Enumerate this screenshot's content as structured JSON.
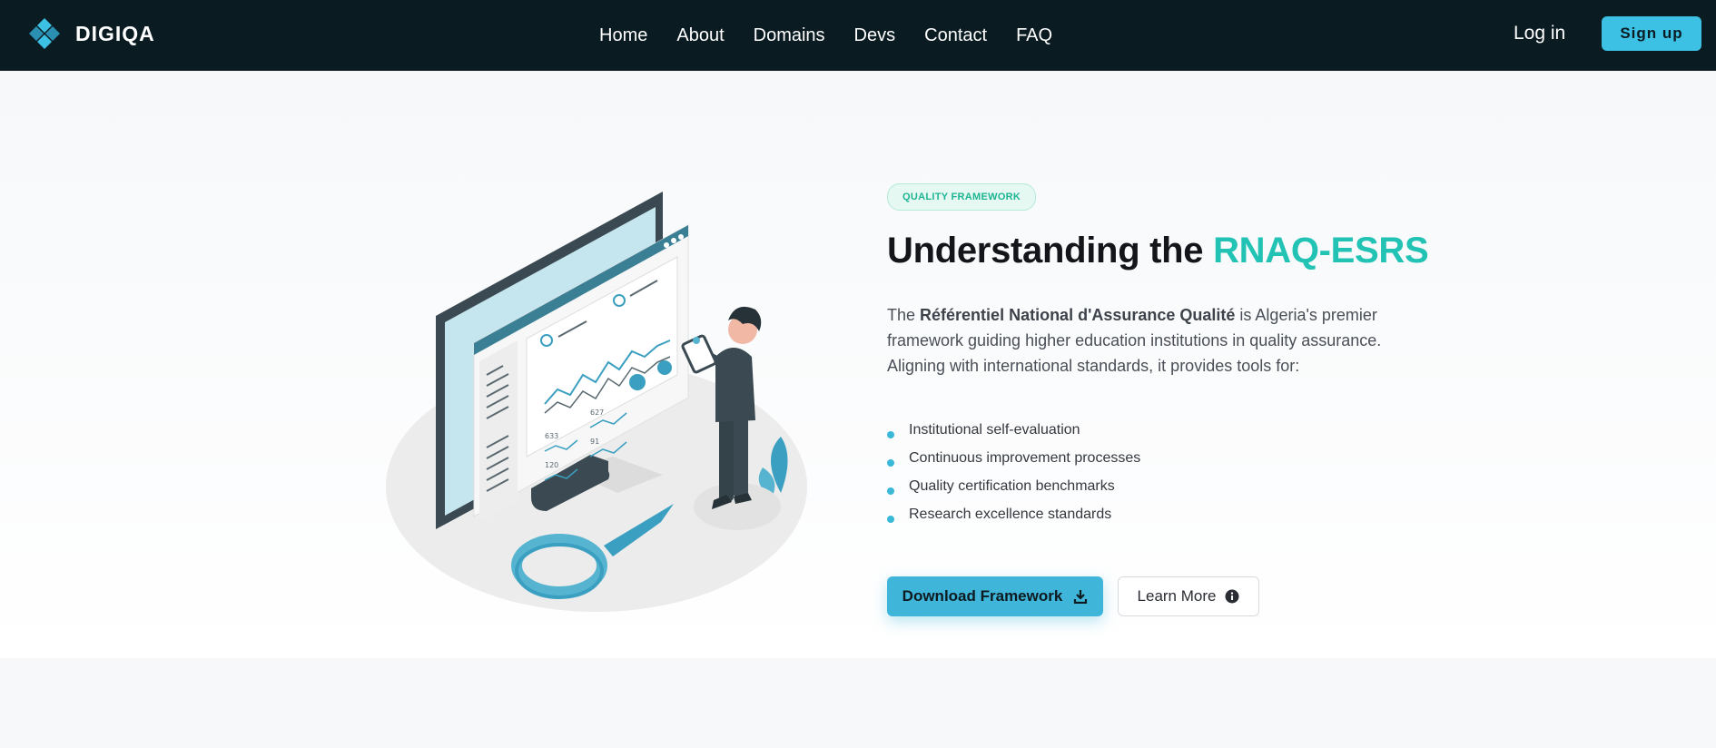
{
  "brand": {
    "name": "DIGIQA",
    "logo_icon": "diamond-cluster-icon",
    "accent": "#3cc1e5"
  },
  "nav": {
    "items": [
      {
        "label": "Home"
      },
      {
        "label": "About"
      },
      {
        "label": "Domains"
      },
      {
        "label": "Devs"
      },
      {
        "label": "Contact"
      },
      {
        "label": "FAQ"
      }
    ],
    "login_label": "Log in",
    "signup_label": "Sign up"
  },
  "hero": {
    "badge": "QUALITY FRAMEWORK",
    "title_prefix": "Understanding the ",
    "title_accent": "RNAQ-ESRS",
    "title_accent_color": "#22c3b4",
    "desc_intro": "The ",
    "desc_bold": "Référentiel National d'Assurance Qualité",
    "desc_rest": " is Algeria's premier framework guiding higher education institutions in quality assurance. Aligning with international standards, it provides tools for:",
    "features": [
      "Institutional self-evaluation",
      "Continuous improvement processes",
      "Quality certification benchmarks",
      "Research excellence standards"
    ],
    "primary_button": "Download Framework",
    "primary_icon": "download-icon",
    "secondary_button": "Learn More",
    "secondary_icon": "info-icon",
    "illustration": {
      "name": "analytics-illustration",
      "chart_labels": [
        "633",
        "627",
        "91",
        "120"
      ]
    }
  }
}
